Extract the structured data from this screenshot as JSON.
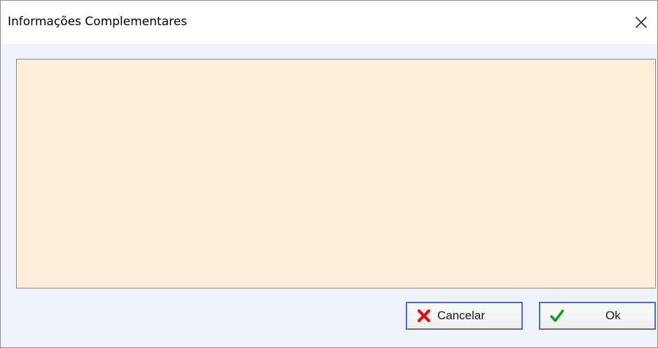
{
  "window": {
    "title": "Informações Complementares",
    "close_icon": "close-icon"
  },
  "memo": {
    "value": "",
    "background_color": "#fdedd9"
  },
  "buttons": {
    "cancel": {
      "label": "Cancelar",
      "icon": "red-x-icon",
      "icon_color": "#e11010"
    },
    "ok": {
      "label": "Ok",
      "icon": "green-checkmark-icon",
      "icon_color": "#1a9a1a"
    }
  }
}
